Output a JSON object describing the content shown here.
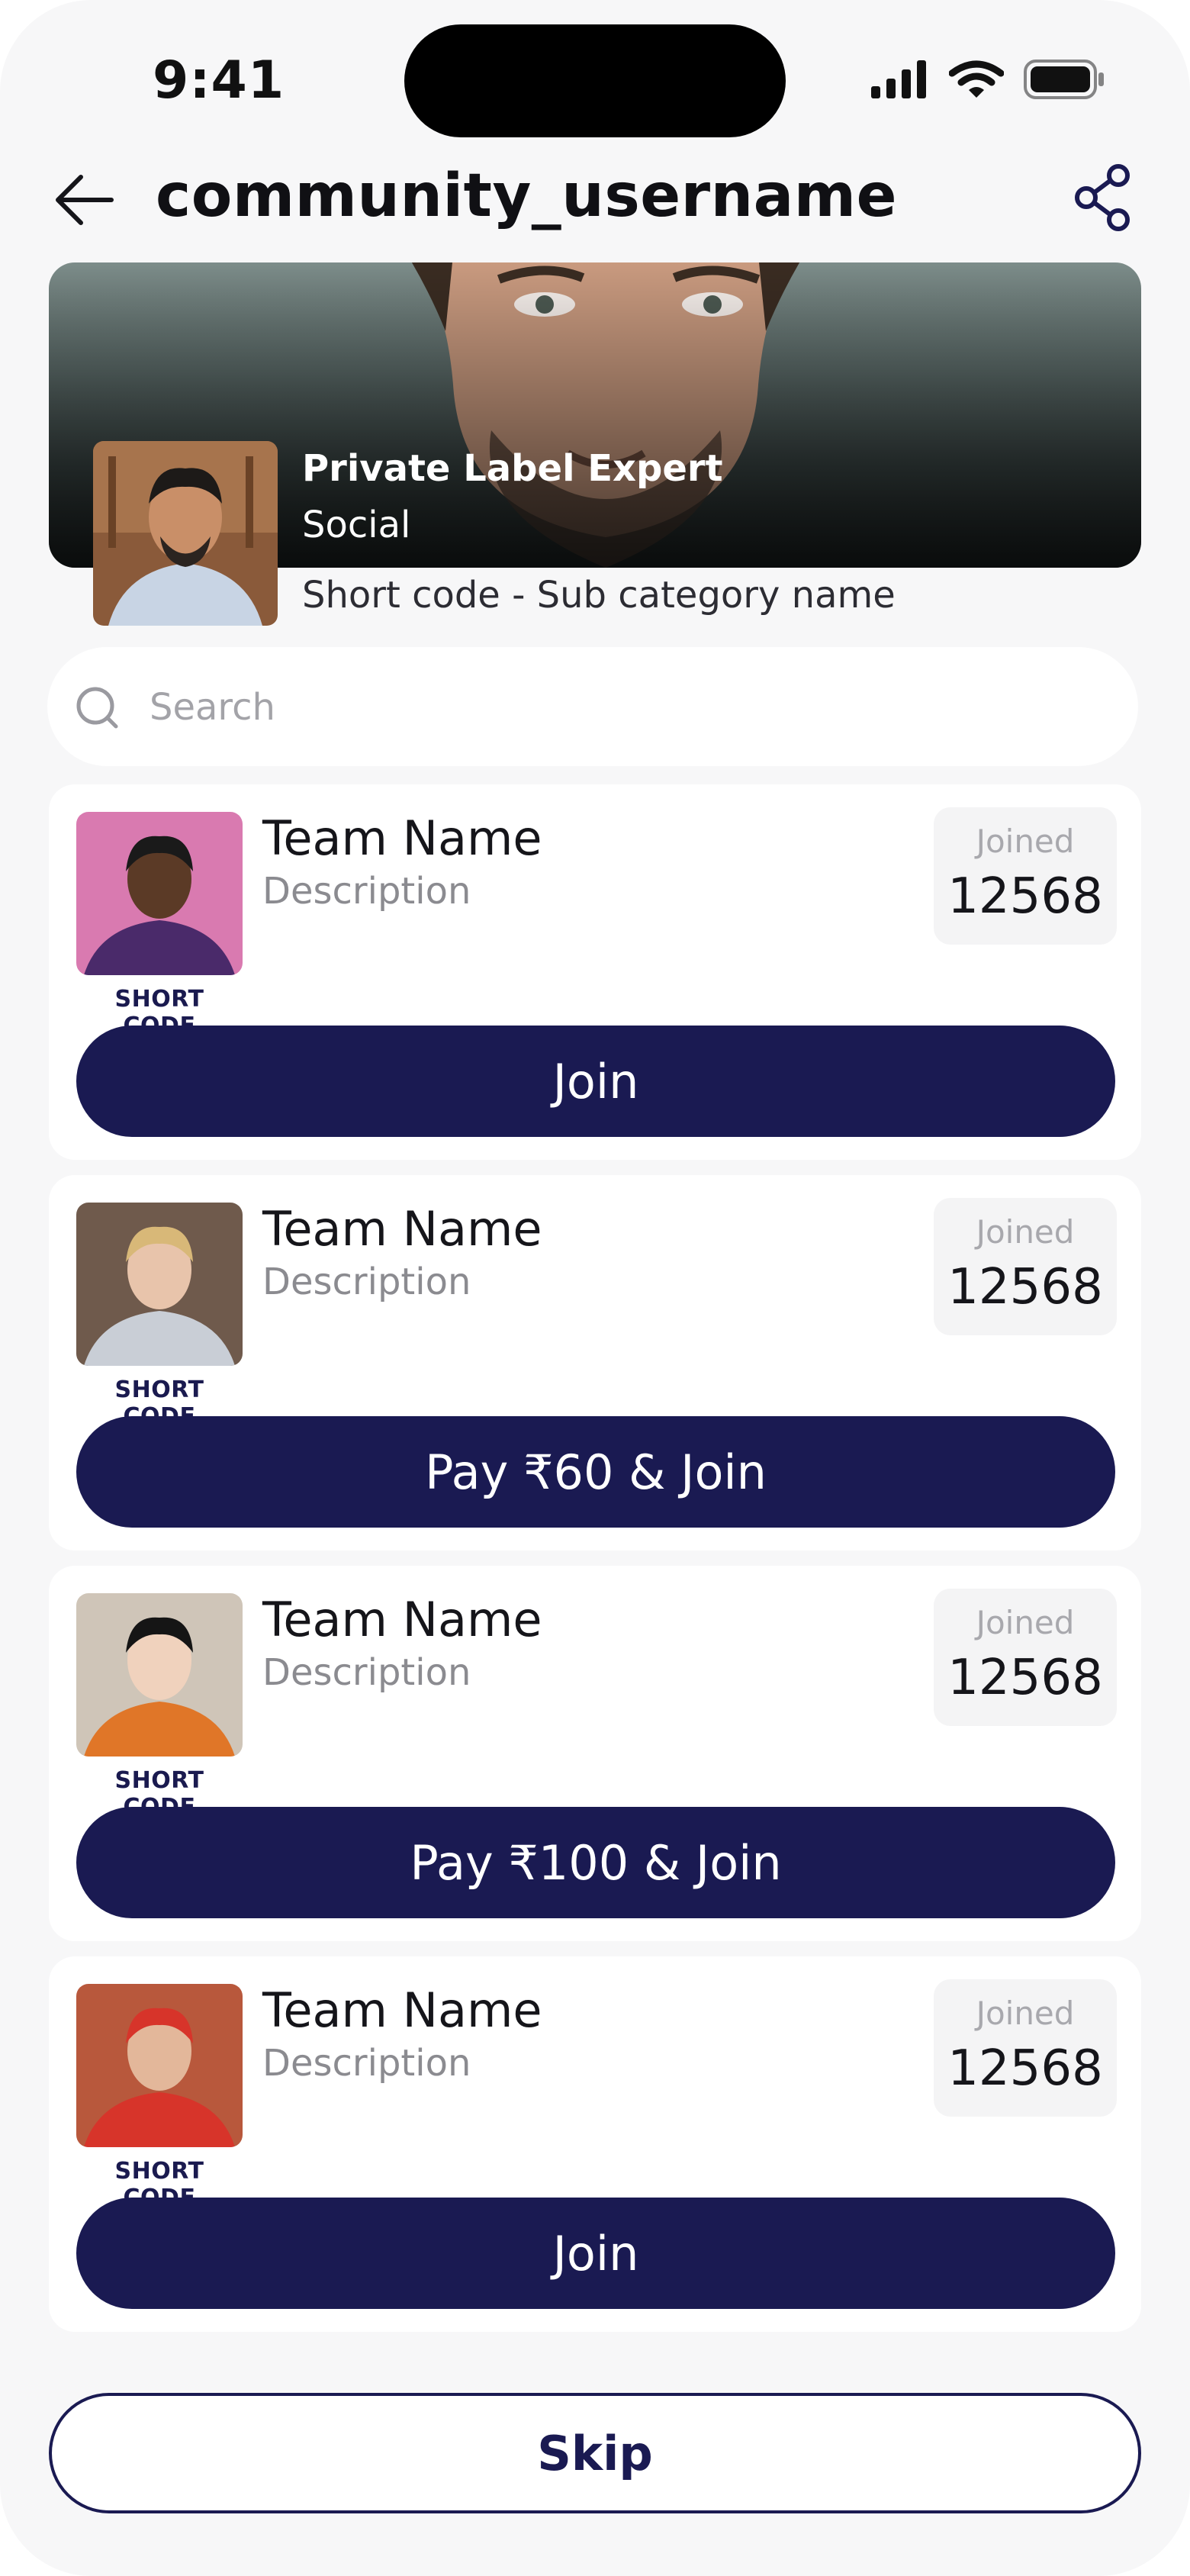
{
  "status_bar": {
    "time": "9:41",
    "icons": [
      "signal-icon",
      "wifi-icon",
      "battery-icon"
    ]
  },
  "header": {
    "title": "community_username",
    "back_icon": "back-arrow-icon",
    "share_icon": "share-icon"
  },
  "profile": {
    "name": "Private Label Expert",
    "type": "Social",
    "subtitle": "Short code - Sub category name"
  },
  "search": {
    "placeholder": "Search",
    "value": ""
  },
  "teams": [
    {
      "name": "Team Name",
      "description": "Description",
      "short_code": "SHORT CODE",
      "joined_label": "Joined",
      "joined_count": "12568",
      "button_label": "Join",
      "avatar_bg": "#d97ab0",
      "shirt": "#4a2a6a",
      "skin": "#5b3a26",
      "hair": "#1a1a1a"
    },
    {
      "name": "Team Name",
      "description": "Description",
      "short_code": "SHORT CODE",
      "joined_label": "Joined",
      "joined_count": "12568",
      "button_label": "Pay ₹60 & Join",
      "avatar_bg": "#6f5a4c",
      "shirt": "#c9ced6",
      "skin": "#e8c4ab",
      "hair": "#d8b878"
    },
    {
      "name": "Team Name",
      "description": "Description",
      "short_code": "SHORT CODE",
      "joined_label": "Joined",
      "joined_count": "12568",
      "button_label": "Pay ₹100 & Join",
      "avatar_bg": "#cfc5b8",
      "shirt": "#e07628",
      "skin": "#f0d2bd",
      "hair": "#151515"
    },
    {
      "name": "Team Name",
      "description": "Description",
      "short_code": "SHORT CODE",
      "joined_label": "Joined",
      "joined_count": "12568",
      "button_label": "Join",
      "avatar_bg": "#b8583c",
      "shirt": "#d7342a",
      "skin": "#e3b79a",
      "hair": "#d7342a"
    }
  ],
  "footer": {
    "skip_label": "Skip"
  },
  "colors": {
    "primary": "#1a1a52",
    "background": "#f7f7f8",
    "card": "#ffffff"
  }
}
